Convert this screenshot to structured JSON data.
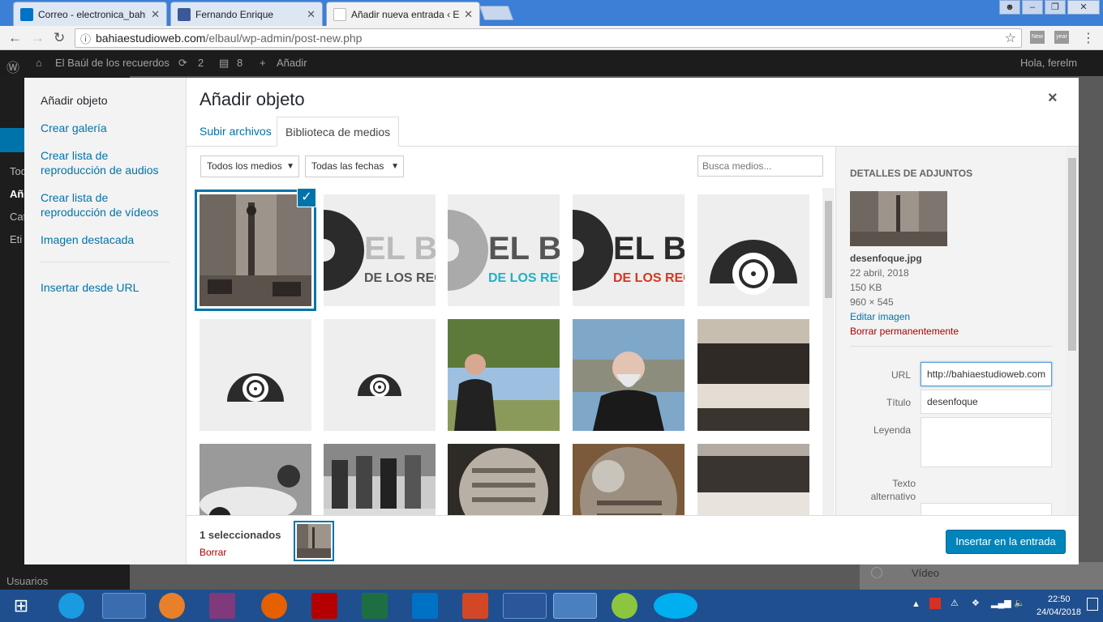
{
  "browser": {
    "tabs": [
      {
        "label": "Correo - electronica_bahi",
        "favicon_color": "#0072c6"
      },
      {
        "label": "Fernando Enrique",
        "favicon_color": "#3b5998"
      },
      {
        "label": "Añadir nueva entrada ‹ E",
        "favicon_color": "#d0d0d0"
      }
    ],
    "url_host": "bahiaestudioweb.com",
    "url_path": "/elbaul/wp-admin/post-new.php",
    "ext1": "New",
    "ext2": "year"
  },
  "wpbar": {
    "site": "El Baúl de los recuerdos",
    "updates": "2",
    "comments": "8",
    "new": "Añadir",
    "greeting": "Hola, ferelm"
  },
  "wpside": {
    "users": "Usuarios",
    "fragment1": "Tod",
    "fragment2": "Añ",
    "fragment3": "Cat",
    "fragment4": "Eti"
  },
  "behind": {
    "video": "Vídeo"
  },
  "modal": {
    "menu": [
      "Añadir objeto",
      "Crear galería",
      "Crear lista de reproducción de audios",
      "Crear lista de reproducción de vídeos",
      "Imagen destacada",
      "Insertar desde URL"
    ],
    "title": "Añadir objeto",
    "close": "×",
    "tabs": [
      "Subir archivos",
      "Biblioteca de medios"
    ],
    "filter_type": "Todos los medios",
    "filter_date": "Todas las fechas",
    "search_placeholder": "Busca medios..."
  },
  "details": {
    "heading": "DETALLES DE ADJUNTOS",
    "filename": "desenfoque.jpg",
    "date": "22 abril, 2018",
    "size": "150 KB",
    "dimensions": "960 × 545",
    "edit": "Editar imagen",
    "delete": "Borrar permanentemente",
    "url_label": "URL",
    "url_value": "http://bahiaestudioweb.com",
    "title_label": "Título",
    "title_value": "desenfoque",
    "caption_label": "Leyenda",
    "alt_label": "Texto alternativo"
  },
  "footer": {
    "count": "1 seleccionados",
    "clear": "Borrar",
    "insert": "Insertar en la entrada"
  },
  "logo_text": {
    "top": "EL BA",
    "bottom": "DE LOS REC"
  },
  "clock": {
    "time": "22:50",
    "date": "24/04/2018"
  }
}
